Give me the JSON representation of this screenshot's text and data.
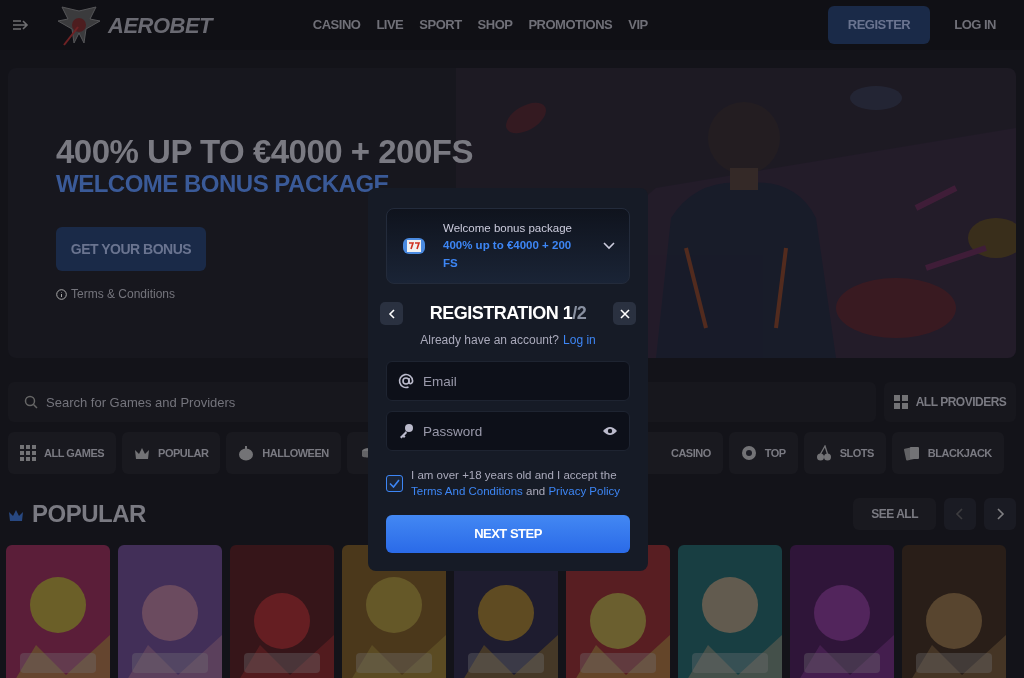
{
  "nav": {
    "logo": "AEROBET",
    "links": [
      "CASINO",
      "LIVE",
      "SPORT",
      "SHOP",
      "PROMOTIONS",
      "VIP"
    ],
    "register": "REGISTER",
    "login": "LOG IN"
  },
  "hero": {
    "title": "400% UP TO €4000 + 200FS",
    "subtitle": "WELCOME BONUS PACKAGE",
    "cta": "GET YOUR BONUS",
    "terms": "Terms & Conditions"
  },
  "search": {
    "placeholder": "Search for Games and Providers"
  },
  "providers_button": "ALL PROVIDERS",
  "categories": [
    {
      "kind": "grid",
      "label": "ALL GAMES"
    },
    {
      "kind": "crown",
      "label": "POPULAR"
    },
    {
      "kind": "pumpkin",
      "label": "HALLOWEEN"
    },
    {
      "kind": "coin"
    },
    {
      "kind": "hidden",
      "label": "CASINO"
    },
    {
      "kind": "badge",
      "label": "TOP"
    },
    {
      "kind": "cherries",
      "label": "SLOTS"
    },
    {
      "kind": "cards",
      "label": "BLACKJACK"
    }
  ],
  "section": {
    "title": "POPULAR",
    "see_all": "SEE ALL"
  },
  "modal": {
    "bonus": {
      "caption": "Welcome bonus package",
      "offer": "400% up to €4000 + 200 FS"
    },
    "title": "REGISTRATION",
    "step": "1",
    "total": "/2",
    "account_prompt": "Already have an account?",
    "login_link": "Log in",
    "email": {
      "placeholder": "Email"
    },
    "password": {
      "placeholder": "Password"
    },
    "consent": {
      "checked": true,
      "text": "I am over +18 years old and I accept the",
      "terms_link": "Terms And Conditions",
      "joiner": "and",
      "privacy_link": "Privacy Policy"
    },
    "submit": "NEXT STEP"
  }
}
